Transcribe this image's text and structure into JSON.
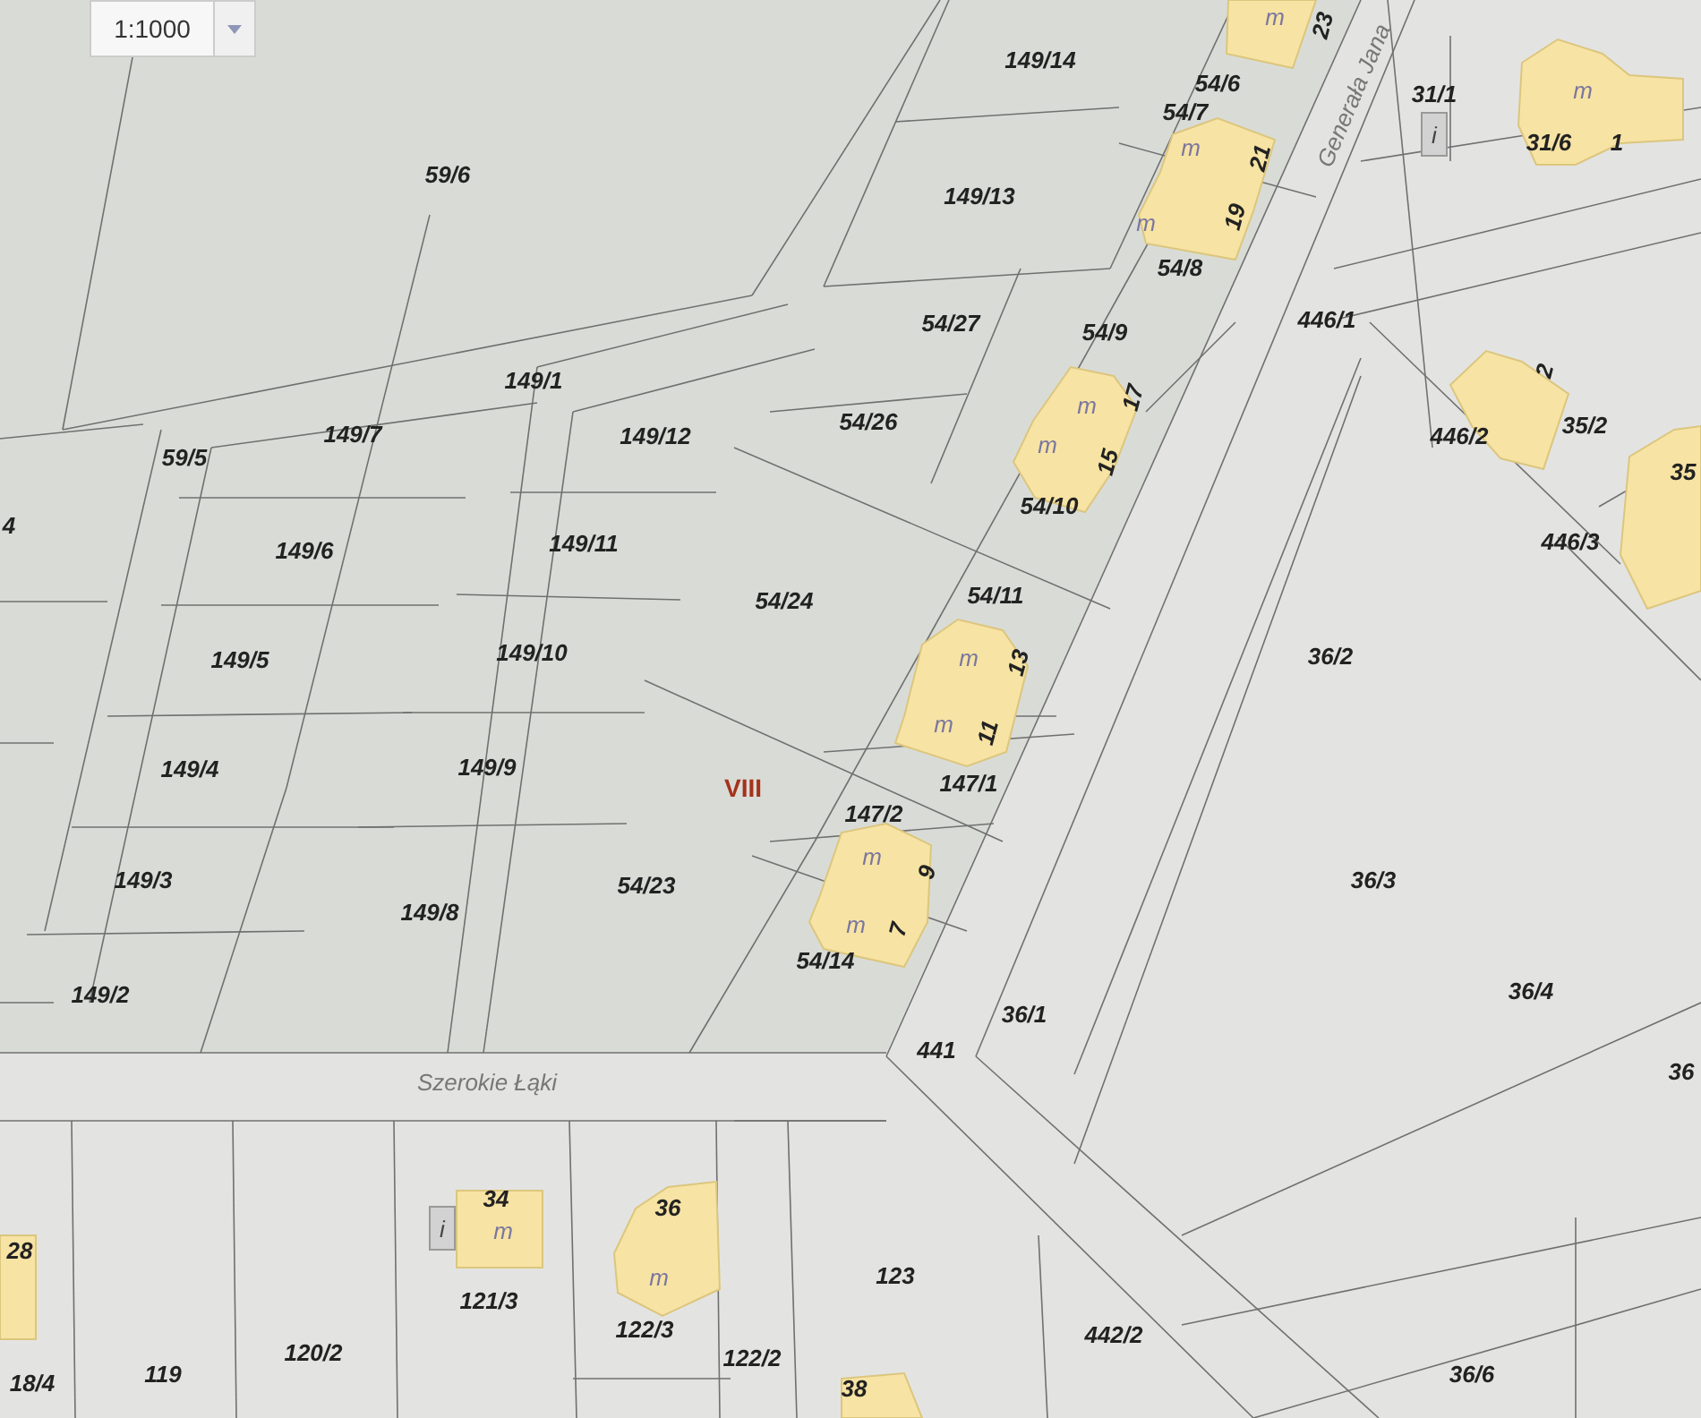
{
  "scale_selector": {
    "value": "1:1000"
  },
  "streets": [
    "Szerokie Łąki",
    "Generała Jana"
  ],
  "district_label": "VIII",
  "parcel_numbers": [
    "149/14",
    "54/6",
    "31/1",
    "54/7",
    "31/6",
    "59/6",
    "149/13",
    "54/8",
    "54/27",
    "54/9",
    "446/1",
    "149/1",
    "59/5",
    "149/7",
    "149/12",
    "54/26",
    "446/2",
    "35/2",
    "35",
    "54/10",
    "4",
    "149/6",
    "149/11",
    "446/3",
    "54/24",
    "54/11",
    "149/5",
    "149/10",
    "36/2",
    "149/4",
    "149/9",
    "147/1",
    "147/2",
    "149/3",
    "149/8",
    "54/23",
    "36/3",
    "54/14",
    "149/2",
    "36/4",
    "36/1",
    "441",
    "36",
    "18/4",
    "119",
    "120/2",
    "121/3",
    "122/3",
    "122/2",
    "123",
    "442/2",
    "36/6"
  ],
  "buildings": [
    {
      "number": "23",
      "use": "m"
    },
    {
      "number": "21",
      "use": "m"
    },
    {
      "number": "19",
      "use": "m"
    },
    {
      "number": "1",
      "use": "m"
    },
    {
      "number": "2"
    },
    {
      "number": "17",
      "use": "m"
    },
    {
      "number": "15",
      "use": "m"
    },
    {
      "number": "13",
      "use": "m"
    },
    {
      "number": "11",
      "use": "m"
    },
    {
      "number": "9",
      "use": "m"
    },
    {
      "number": "7",
      "use": "m"
    },
    {
      "number": "34",
      "use": "m"
    },
    {
      "number": "36",
      "use": "m"
    },
    {
      "number": "38"
    },
    {
      "number": "28"
    }
  ],
  "annex_markers": [
    "i",
    "i"
  ]
}
